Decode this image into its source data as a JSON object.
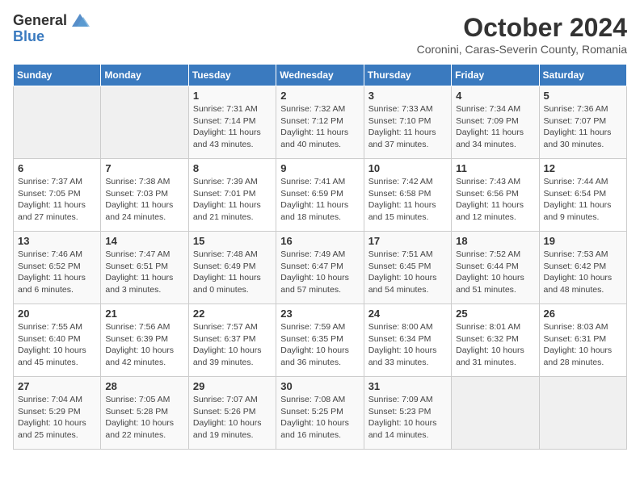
{
  "header": {
    "logo_line1": "General",
    "logo_line2": "Blue",
    "month": "October 2024",
    "location": "Coronini, Caras-Severin County, Romania"
  },
  "weekdays": [
    "Sunday",
    "Monday",
    "Tuesday",
    "Wednesday",
    "Thursday",
    "Friday",
    "Saturday"
  ],
  "weeks": [
    [
      {
        "day": "",
        "sunrise": "",
        "sunset": "",
        "daylight": ""
      },
      {
        "day": "",
        "sunrise": "",
        "sunset": "",
        "daylight": ""
      },
      {
        "day": "1",
        "sunrise": "Sunrise: 7:31 AM",
        "sunset": "Sunset: 7:14 PM",
        "daylight": "Daylight: 11 hours and 43 minutes."
      },
      {
        "day": "2",
        "sunrise": "Sunrise: 7:32 AM",
        "sunset": "Sunset: 7:12 PM",
        "daylight": "Daylight: 11 hours and 40 minutes."
      },
      {
        "day": "3",
        "sunrise": "Sunrise: 7:33 AM",
        "sunset": "Sunset: 7:10 PM",
        "daylight": "Daylight: 11 hours and 37 minutes."
      },
      {
        "day": "4",
        "sunrise": "Sunrise: 7:34 AM",
        "sunset": "Sunset: 7:09 PM",
        "daylight": "Daylight: 11 hours and 34 minutes."
      },
      {
        "day": "5",
        "sunrise": "Sunrise: 7:36 AM",
        "sunset": "Sunset: 7:07 PM",
        "daylight": "Daylight: 11 hours and 30 minutes."
      }
    ],
    [
      {
        "day": "6",
        "sunrise": "Sunrise: 7:37 AM",
        "sunset": "Sunset: 7:05 PM",
        "daylight": "Daylight: 11 hours and 27 minutes."
      },
      {
        "day": "7",
        "sunrise": "Sunrise: 7:38 AM",
        "sunset": "Sunset: 7:03 PM",
        "daylight": "Daylight: 11 hours and 24 minutes."
      },
      {
        "day": "8",
        "sunrise": "Sunrise: 7:39 AM",
        "sunset": "Sunset: 7:01 PM",
        "daylight": "Daylight: 11 hours and 21 minutes."
      },
      {
        "day": "9",
        "sunrise": "Sunrise: 7:41 AM",
        "sunset": "Sunset: 6:59 PM",
        "daylight": "Daylight: 11 hours and 18 minutes."
      },
      {
        "day": "10",
        "sunrise": "Sunrise: 7:42 AM",
        "sunset": "Sunset: 6:58 PM",
        "daylight": "Daylight: 11 hours and 15 minutes."
      },
      {
        "day": "11",
        "sunrise": "Sunrise: 7:43 AM",
        "sunset": "Sunset: 6:56 PM",
        "daylight": "Daylight: 11 hours and 12 minutes."
      },
      {
        "day": "12",
        "sunrise": "Sunrise: 7:44 AM",
        "sunset": "Sunset: 6:54 PM",
        "daylight": "Daylight: 11 hours and 9 minutes."
      }
    ],
    [
      {
        "day": "13",
        "sunrise": "Sunrise: 7:46 AM",
        "sunset": "Sunset: 6:52 PM",
        "daylight": "Daylight: 11 hours and 6 minutes."
      },
      {
        "day": "14",
        "sunrise": "Sunrise: 7:47 AM",
        "sunset": "Sunset: 6:51 PM",
        "daylight": "Daylight: 11 hours and 3 minutes."
      },
      {
        "day": "15",
        "sunrise": "Sunrise: 7:48 AM",
        "sunset": "Sunset: 6:49 PM",
        "daylight": "Daylight: 11 hours and 0 minutes."
      },
      {
        "day": "16",
        "sunrise": "Sunrise: 7:49 AM",
        "sunset": "Sunset: 6:47 PM",
        "daylight": "Daylight: 10 hours and 57 minutes."
      },
      {
        "day": "17",
        "sunrise": "Sunrise: 7:51 AM",
        "sunset": "Sunset: 6:45 PM",
        "daylight": "Daylight: 10 hours and 54 minutes."
      },
      {
        "day": "18",
        "sunrise": "Sunrise: 7:52 AM",
        "sunset": "Sunset: 6:44 PM",
        "daylight": "Daylight: 10 hours and 51 minutes."
      },
      {
        "day": "19",
        "sunrise": "Sunrise: 7:53 AM",
        "sunset": "Sunset: 6:42 PM",
        "daylight": "Daylight: 10 hours and 48 minutes."
      }
    ],
    [
      {
        "day": "20",
        "sunrise": "Sunrise: 7:55 AM",
        "sunset": "Sunset: 6:40 PM",
        "daylight": "Daylight: 10 hours and 45 minutes."
      },
      {
        "day": "21",
        "sunrise": "Sunrise: 7:56 AM",
        "sunset": "Sunset: 6:39 PM",
        "daylight": "Daylight: 10 hours and 42 minutes."
      },
      {
        "day": "22",
        "sunrise": "Sunrise: 7:57 AM",
        "sunset": "Sunset: 6:37 PM",
        "daylight": "Daylight: 10 hours and 39 minutes."
      },
      {
        "day": "23",
        "sunrise": "Sunrise: 7:59 AM",
        "sunset": "Sunset: 6:35 PM",
        "daylight": "Daylight: 10 hours and 36 minutes."
      },
      {
        "day": "24",
        "sunrise": "Sunrise: 8:00 AM",
        "sunset": "Sunset: 6:34 PM",
        "daylight": "Daylight: 10 hours and 33 minutes."
      },
      {
        "day": "25",
        "sunrise": "Sunrise: 8:01 AM",
        "sunset": "Sunset: 6:32 PM",
        "daylight": "Daylight: 10 hours and 31 minutes."
      },
      {
        "day": "26",
        "sunrise": "Sunrise: 8:03 AM",
        "sunset": "Sunset: 6:31 PM",
        "daylight": "Daylight: 10 hours and 28 minutes."
      }
    ],
    [
      {
        "day": "27",
        "sunrise": "Sunrise: 7:04 AM",
        "sunset": "Sunset: 5:29 PM",
        "daylight": "Daylight: 10 hours and 25 minutes."
      },
      {
        "day": "28",
        "sunrise": "Sunrise: 7:05 AM",
        "sunset": "Sunset: 5:28 PM",
        "daylight": "Daylight: 10 hours and 22 minutes."
      },
      {
        "day": "29",
        "sunrise": "Sunrise: 7:07 AM",
        "sunset": "Sunset: 5:26 PM",
        "daylight": "Daylight: 10 hours and 19 minutes."
      },
      {
        "day": "30",
        "sunrise": "Sunrise: 7:08 AM",
        "sunset": "Sunset: 5:25 PM",
        "daylight": "Daylight: 10 hours and 16 minutes."
      },
      {
        "day": "31",
        "sunrise": "Sunrise: 7:09 AM",
        "sunset": "Sunset: 5:23 PM",
        "daylight": "Daylight: 10 hours and 14 minutes."
      },
      {
        "day": "",
        "sunrise": "",
        "sunset": "",
        "daylight": ""
      },
      {
        "day": "",
        "sunrise": "",
        "sunset": "",
        "daylight": ""
      }
    ]
  ]
}
